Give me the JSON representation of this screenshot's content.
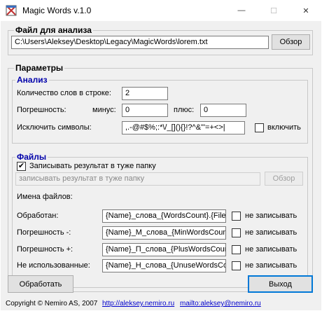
{
  "window": {
    "title": "Magic Words v.1.0",
    "minimize_glyph": "—",
    "maximize_glyph": "☐",
    "close_glyph": "✕",
    "icon": "app-icon"
  },
  "file_section": {
    "title": "Файл для анализа",
    "path": "C:\\Users\\Aleksey\\Desktop\\Legacy\\MagicWords\\lorem.txt",
    "browse_label": "Обзор"
  },
  "params": {
    "title": "Параметры",
    "analysis": {
      "title": "Анализ",
      "words_count_label": "Количество слов в строке:",
      "words_count_value": "2",
      "error_label": "Погрешность:",
      "minus_label": "минус:",
      "minus_value": "0",
      "plus_label": "плюс:",
      "plus_value": "0",
      "exclude_label": "Исключить символы:",
      "exclude_value": ",.-@#$%;:*\\/_[](){}!?^&\"'=+<>|",
      "exclude_toggle_label": "включить",
      "exclude_toggle_checked": false
    },
    "files": {
      "title": "Файлы",
      "same_folder_label": "Записывать результат в туже папку",
      "same_folder_checked": true,
      "folder_field_value": "записывать результат в туже папку",
      "folder_browse_label": "Обзор",
      "names_label": "Имена файлов:",
      "rows": [
        {
          "label": "Обработан:",
          "value": "{Name}_слова_{WordsCount}.{FileType}",
          "skip_label": "не записывать",
          "skip_checked": false
        },
        {
          "label": "Погрешность -:",
          "value": "{Name}_М_слова_{MinWordsCount}",
          "skip_label": "не записывать",
          "skip_checked": false
        },
        {
          "label": "Погрешность +:",
          "value": "{Name}_П_слова_{PlusWordsCount}",
          "skip_label": "не записывать",
          "skip_checked": false
        },
        {
          "label": "Не использованные:",
          "value": "{Name}_Н_слова_{UnuseWordsCount}",
          "skip_label": "не записывать",
          "skip_checked": false
        }
      ]
    }
  },
  "actions": {
    "process_label": "Обработать",
    "exit_label": "Выход"
  },
  "footer": {
    "copyright": "Copyright © Nemiro AS, 2007",
    "site_link": "http://aleksey.nemiro.ru",
    "mail_link": "mailto:aleksey@nemiro.ru"
  }
}
